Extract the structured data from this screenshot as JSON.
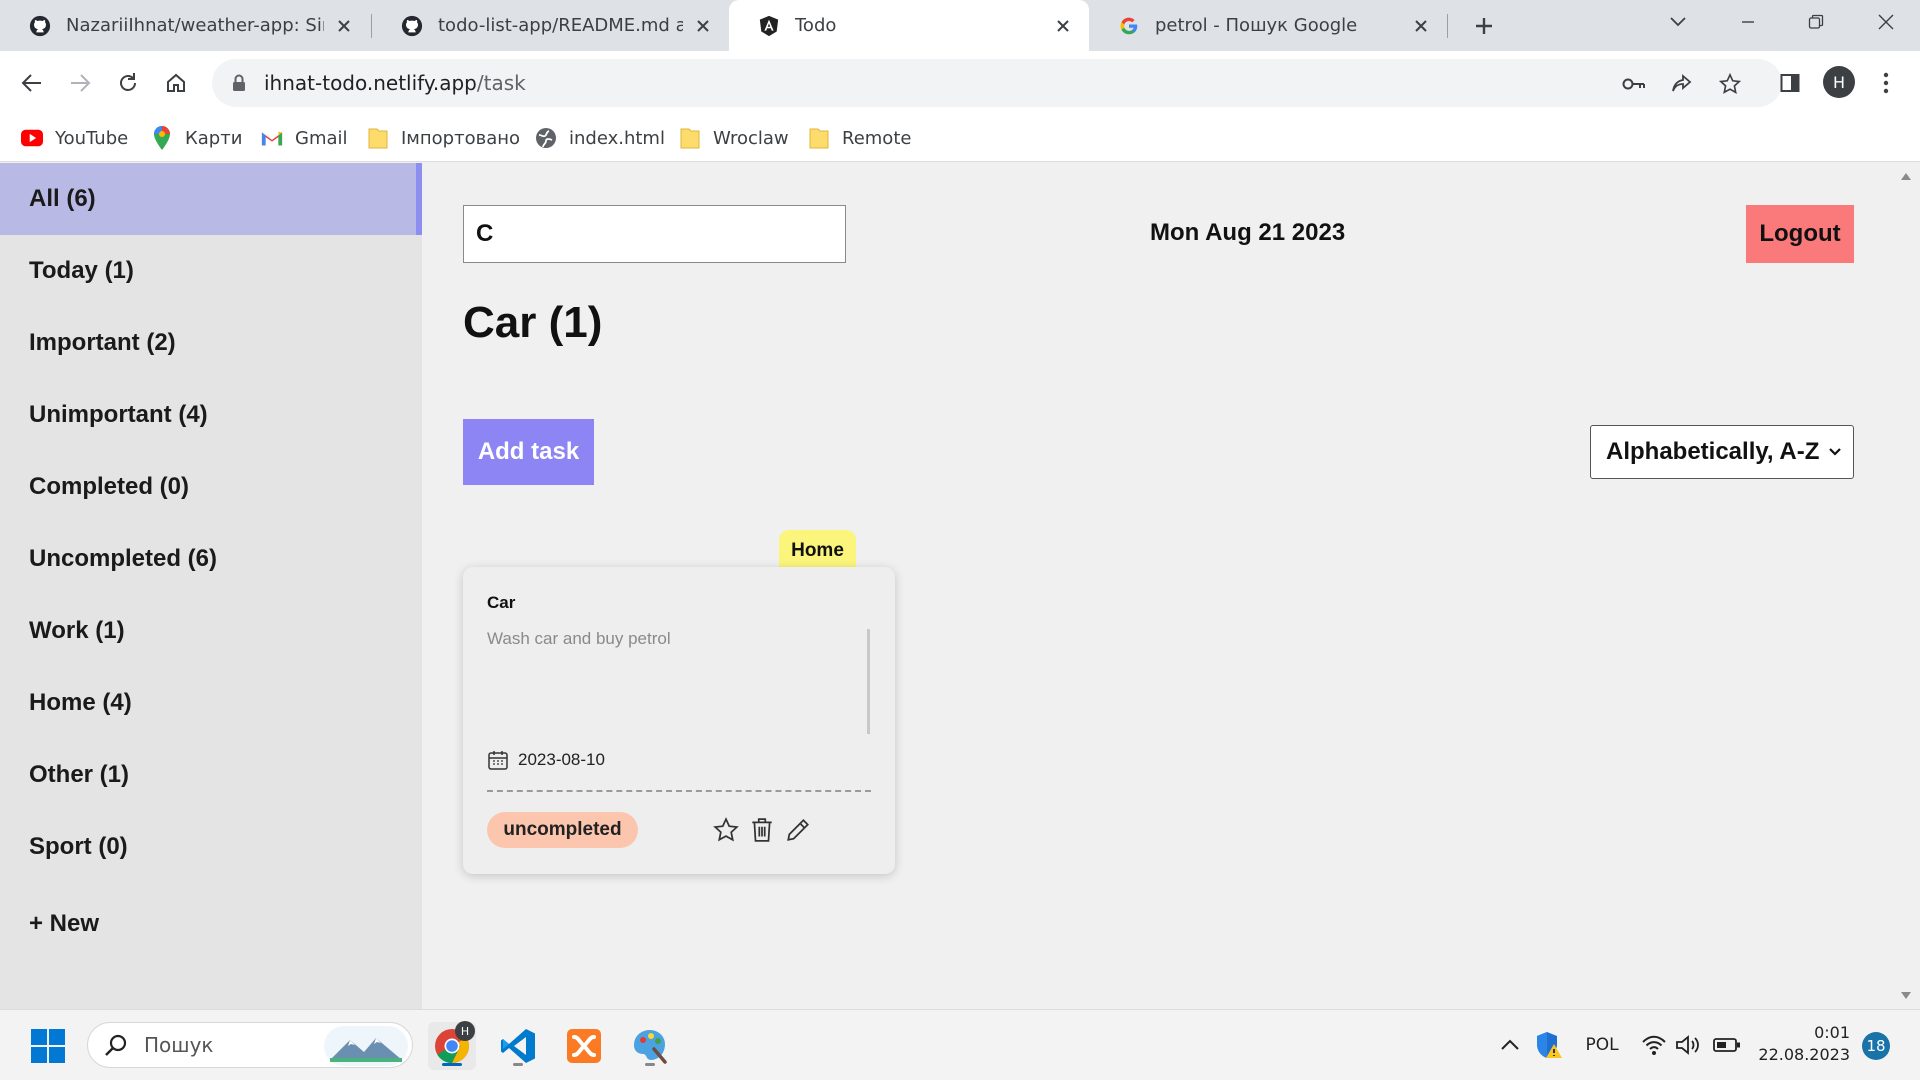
{
  "browser": {
    "tabs": [
      {
        "title": "NazariiIhnat/weather-app: Simple",
        "icon": "github-icon"
      },
      {
        "title": "todo-list-app/README.md at ma",
        "icon": "github-icon"
      },
      {
        "title": "Todo",
        "icon": "angular-icon"
      },
      {
        "title": "petrol - Пошук Google",
        "icon": "google-icon"
      }
    ],
    "url_domain": "ihnat-todo.netlify.app",
    "url_path": "/task",
    "profile_initial": "H",
    "bookmarks": [
      {
        "label": "YouTube",
        "icon": "youtube-icon"
      },
      {
        "label": "Карти",
        "icon": "maps-icon"
      },
      {
        "label": "Gmail",
        "icon": "gmail-icon"
      },
      {
        "label": "Імпортовано",
        "icon": "folder-icon"
      },
      {
        "label": "index.html",
        "icon": "globe-icon"
      },
      {
        "label": "Wroclaw",
        "icon": "folder-icon"
      },
      {
        "label": "Remote",
        "icon": "folder-icon"
      }
    ]
  },
  "sidebar": {
    "items": [
      {
        "label": "All (6)",
        "active": true
      },
      {
        "label": "Today (1)"
      },
      {
        "label": "Important (2)"
      },
      {
        "label": "Unimportant (4)"
      },
      {
        "label": "Completed (0)"
      },
      {
        "label": "Uncompleted (6)"
      },
      {
        "label": "Work (1)"
      },
      {
        "label": "Home (4)"
      },
      {
        "label": "Other (1)"
      },
      {
        "label": "Sport (0)"
      }
    ],
    "new_label": "+ New"
  },
  "main": {
    "search_value": "C",
    "date": "Mon Aug 21 2023",
    "logout_label": "Logout",
    "title": "Car (1)",
    "add_task_label": "Add task",
    "sort_value": "Alphabetically, A-Z"
  },
  "task": {
    "tag": "Home",
    "title": "Car",
    "description": "Wash car and buy petrol",
    "date": "2023-08-10",
    "status": "uncompleted"
  },
  "taskbar": {
    "search_placeholder": "Пошук",
    "language": "POL",
    "time": "0:01",
    "date": "22.08.2023",
    "notifications": "18",
    "profile_badge": "H"
  },
  "colors": {
    "sidebar_active": "#b9b9e6",
    "add_task": "#8e85f5",
    "logout": "#fa7a7c",
    "tag": "#fbf57c",
    "status": "#fcc5ad"
  }
}
